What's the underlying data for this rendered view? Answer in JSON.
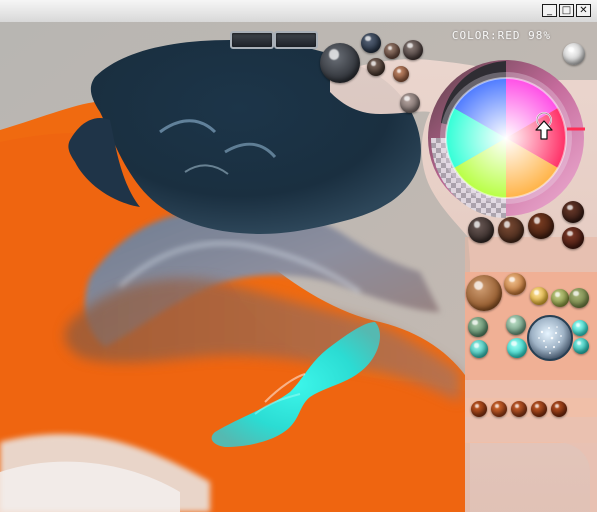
{
  "window": {
    "buttons": {
      "minimize": "_",
      "maximize": "□",
      "close": "✕"
    }
  },
  "status": {
    "color_readout": "COLOR:RED 98%"
  },
  "colors": {
    "orange": "#f06a10",
    "navy": "#1c3448",
    "cyan": "#29e0d4",
    "panel": "#f2ae92",
    "copper": "#9c4a20"
  },
  "tools": {
    "cursor": "pointer-arrow-icon",
    "color_wheel_icon": "color-wheel-icon",
    "selector_icon": "hue-selector-ring-icon"
  }
}
